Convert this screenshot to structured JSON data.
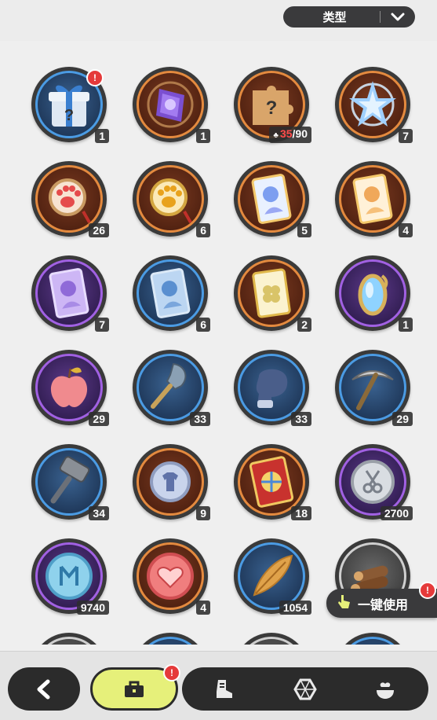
{
  "filter": {
    "label": "类型"
  },
  "items": [
    {
      "name": "mystery-gift",
      "rarity": "blue",
      "count": "1",
      "alert": "!"
    },
    {
      "name": "purple-crystal-relic",
      "rarity": "orange",
      "count": "1"
    },
    {
      "name": "mystery-puzzle",
      "rarity": "orange",
      "count_current": "35",
      "count_total": "/90"
    },
    {
      "name": "blue-crystal-star",
      "rarity": "orange",
      "count": "7"
    },
    {
      "name": "red-paw-charm",
      "rarity": "orange",
      "count": "26"
    },
    {
      "name": "gold-paw-charm",
      "rarity": "orange",
      "count": "6"
    },
    {
      "name": "blue-girl-card",
      "rarity": "orange",
      "count": "5"
    },
    {
      "name": "orange-girl-card",
      "rarity": "orange",
      "count": "4"
    },
    {
      "name": "purple-card",
      "rarity": "purple",
      "count": "7"
    },
    {
      "name": "blue-card",
      "rarity": "blue",
      "count": "6"
    },
    {
      "name": "clover-ticket",
      "rarity": "orange",
      "count": "2"
    },
    {
      "name": "magic-mirror",
      "rarity": "purple",
      "count": "1"
    },
    {
      "name": "pink-apple",
      "rarity": "purple",
      "count": "29"
    },
    {
      "name": "shovel",
      "rarity": "blue",
      "count": "33"
    },
    {
      "name": "boxing-glove",
      "rarity": "blue",
      "count": "33"
    },
    {
      "name": "pickaxe",
      "rarity": "blue",
      "count": "29"
    },
    {
      "name": "hammer",
      "rarity": "blue",
      "count": "34"
    },
    {
      "name": "shirt-coin",
      "rarity": "orange",
      "count": "9"
    },
    {
      "name": "wheel-ticket",
      "rarity": "orange",
      "count": "18"
    },
    {
      "name": "silver-scissor-coin",
      "rarity": "purple",
      "count": "2700"
    },
    {
      "name": "blue-rune-coin",
      "rarity": "purple",
      "count": "9740"
    },
    {
      "name": "heart-coin",
      "rarity": "orange",
      "count": "4"
    },
    {
      "name": "golden-feather",
      "rarity": "blue",
      "count": "1054"
    },
    {
      "name": "wood-logs",
      "rarity": "gray",
      "count": ""
    },
    {
      "name": "partial-item-1",
      "rarity": "gray",
      "count": ""
    },
    {
      "name": "partial-item-2",
      "rarity": "blue",
      "count": ""
    },
    {
      "name": "partial-item-3",
      "rarity": "gray",
      "count": ""
    },
    {
      "name": "partial-item-4",
      "rarity": "blue",
      "count": ""
    }
  ],
  "quick_use": {
    "label": "一键使用",
    "alert": "!"
  },
  "nav": {
    "tabs": [
      {
        "name": "bag",
        "icon": "bag-icon",
        "active": true,
        "alert": "!"
      },
      {
        "name": "equipment",
        "icon": "boots-icon"
      },
      {
        "name": "gems",
        "icon": "gem-icon"
      },
      {
        "name": "food",
        "icon": "food-icon"
      }
    ]
  },
  "colors": {
    "orange": "#e38a3f",
    "blue": "#4b9be3",
    "purple": "#a161e2",
    "accent": "#e6f07a",
    "alert": "#e53a3a"
  }
}
